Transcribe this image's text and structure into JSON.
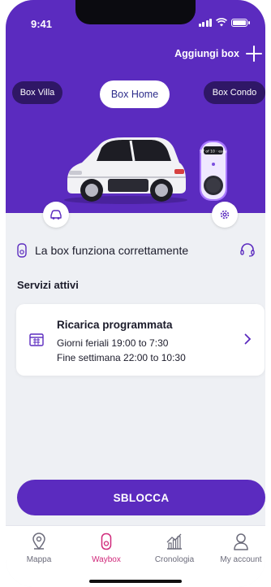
{
  "status_bar": {
    "time": "9:41"
  },
  "header": {
    "add_box_label": "Aggiungi box",
    "chips": [
      {
        "label": "Box Villa",
        "active": false
      },
      {
        "label": "Box Home",
        "active": true
      },
      {
        "label": "Box Condo",
        "active": false
      }
    ],
    "charger_screen_text": "97 of 10 · easy"
  },
  "status": {
    "text": "La box funziona correttamente"
  },
  "services": {
    "title": "Servizi attivi",
    "card": {
      "title": "Ricarica programmata",
      "line1": "Giorni feriali 19:00 to 7:30",
      "line2": "Fine settimana 22:00 to 10:30"
    }
  },
  "unlock_button": {
    "label": "SBLOCCA"
  },
  "tabbar": {
    "items": [
      {
        "label": "Mappa",
        "icon": "map-pin-icon",
        "active": false
      },
      {
        "label": "Waybox",
        "icon": "charger-icon",
        "active": true
      },
      {
        "label": "Cronologia",
        "icon": "chart-icon",
        "active": false
      },
      {
        "label": "My account",
        "icon": "user-icon",
        "active": false
      }
    ]
  },
  "colors": {
    "primary": "#5b2bbf",
    "accent": "#d0287a",
    "chip_bg": "#2f1766",
    "background": "#eef0f4"
  }
}
